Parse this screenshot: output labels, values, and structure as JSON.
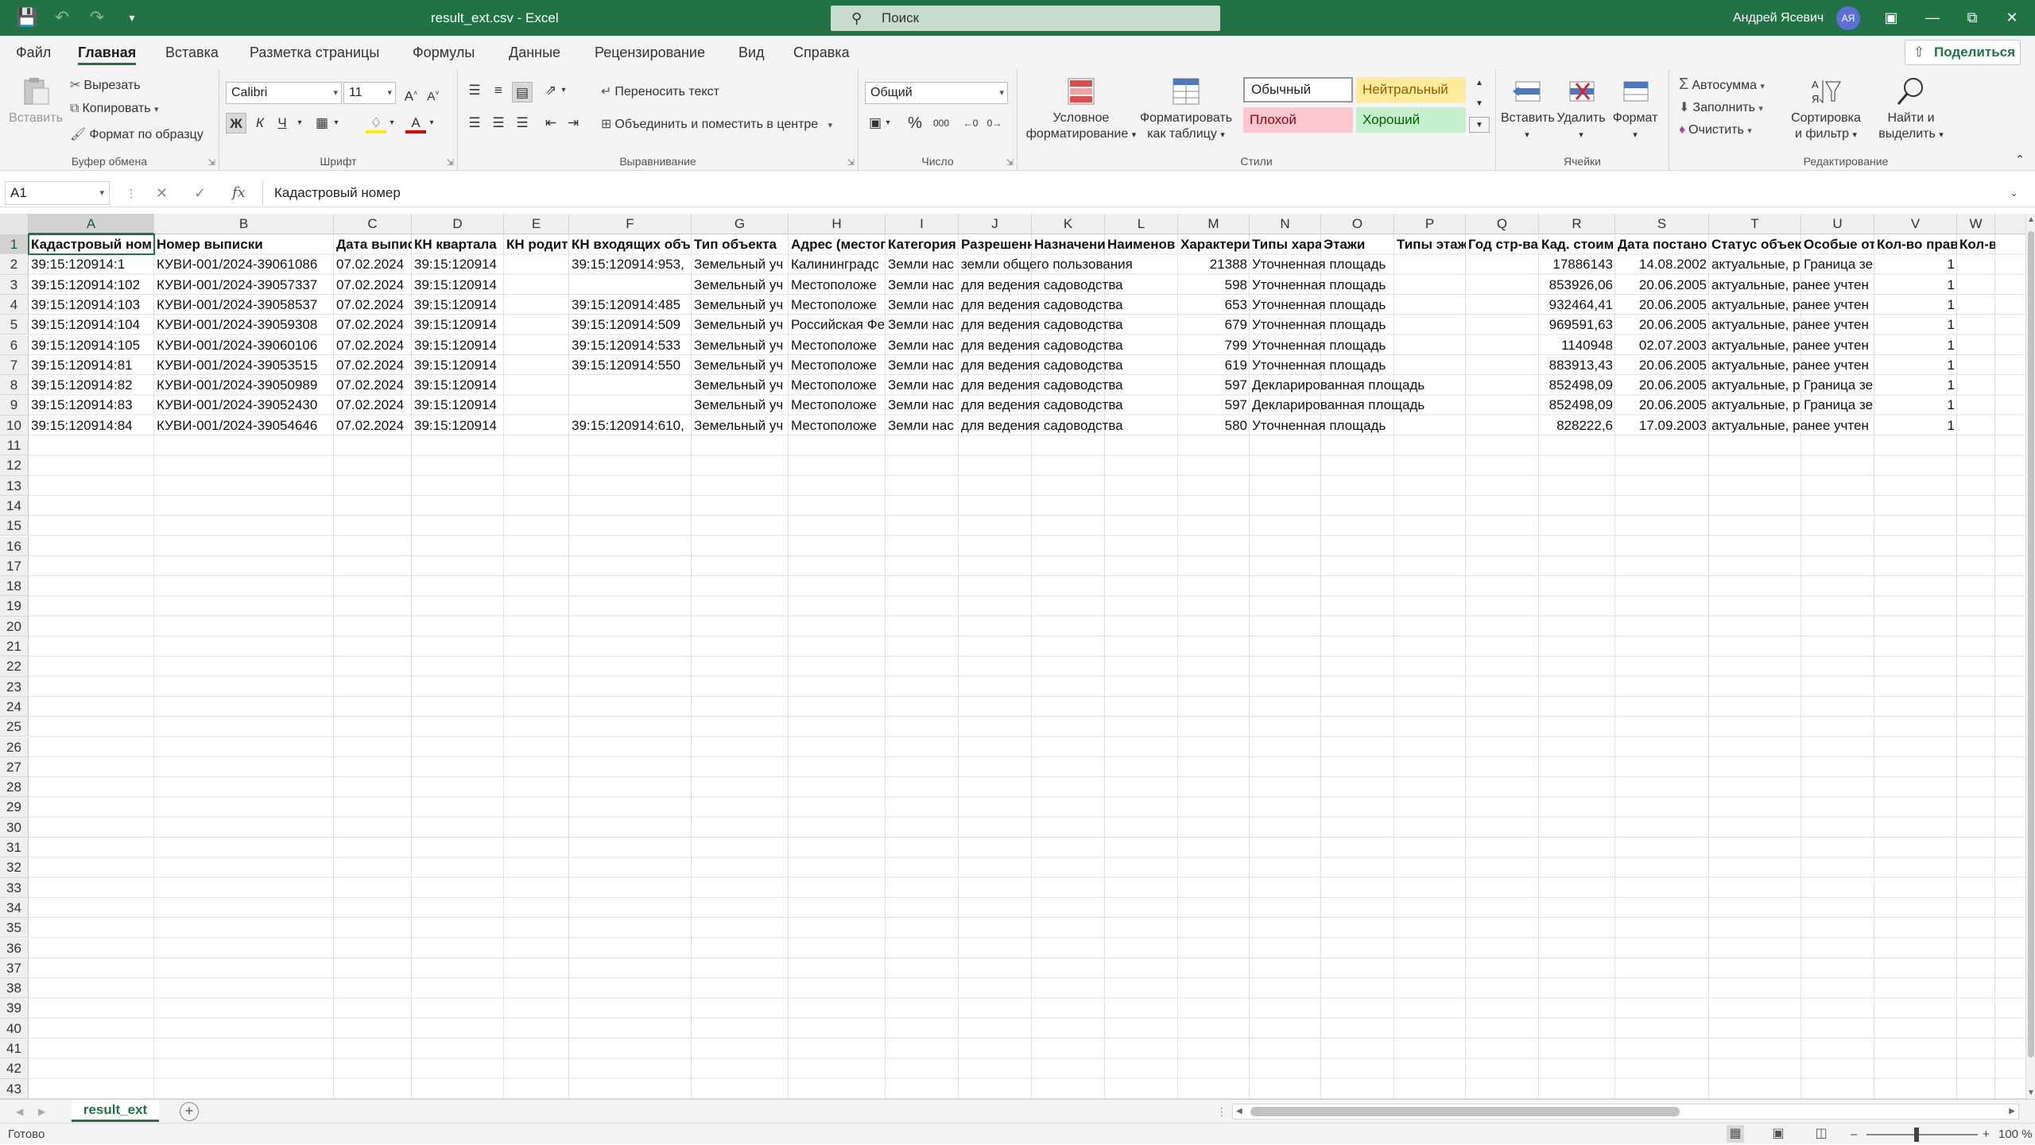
{
  "titlebar": {
    "title": "result_ext.csv  -  Excel",
    "search_placeholder": "Поиск",
    "user": "Андрей Ясевич",
    "avatar_initials": "АЯ"
  },
  "menu": {
    "tabs": [
      "Файл",
      "Главная",
      "Вставка",
      "Разметка страницы",
      "Формулы",
      "Данные",
      "Рецензирование",
      "Вид",
      "Справка"
    ],
    "active": "Главная",
    "share": "Поделиться"
  },
  "ribbon": {
    "clipboard": {
      "label": "Буфер обмена",
      "paste": "Вставить",
      "cut": "Вырезать",
      "copy": "Копировать",
      "format_painter": "Формат по образцу"
    },
    "font": {
      "label": "Шрифт",
      "name": "Calibri",
      "size": "11",
      "bold": "Ж",
      "italic": "К",
      "underline": "Ч"
    },
    "alignment": {
      "label": "Выравнивание",
      "wrap": "Переносить текст",
      "merge": "Объединить и поместить в центре"
    },
    "number": {
      "label": "Число",
      "format": "Общий",
      "percent": "%",
      "thousands": "000"
    },
    "styles": {
      "label": "Стили",
      "conditional_1": "Условное",
      "conditional_2": "форматирование",
      "as_table_1": "Форматировать",
      "as_table_2": "как таблицу",
      "normal": "Обычный",
      "neutral": "Нейтральный",
      "bad": "Плохой",
      "good": "Хороший"
    },
    "cells": {
      "label": "Ячейки",
      "insert": "Вставить",
      "delete": "Удалить",
      "format": "Формат"
    },
    "editing": {
      "label": "Редактирование",
      "autosum": "Автосумма",
      "fill": "Заполнить",
      "clear": "Очистить",
      "sort_1": "Сортировка",
      "sort_2": "и фильтр",
      "find_1": "Найти и",
      "find_2": "выделить"
    }
  },
  "formula_bar": {
    "name_box": "A1",
    "fx": "fx",
    "value": "Кадастровый номер"
  },
  "sheet": {
    "columns": [
      "A",
      "B",
      "C",
      "D",
      "E",
      "F",
      "G",
      "H",
      "I",
      "J",
      "K",
      "L",
      "M",
      "N",
      "O",
      "P",
      "Q",
      "R",
      "S",
      "T",
      "U",
      "V",
      "W"
    ],
    "row_numbers": [
      "1",
      "2",
      "3",
      "4",
      "5",
      "6",
      "7",
      "8",
      "9",
      "10",
      "11",
      "12",
      "13",
      "14",
      "15",
      "16",
      "17",
      "18",
      "19",
      "20",
      "21",
      "22",
      "23",
      "24",
      "25",
      "26",
      "27",
      "28",
      "29",
      "30",
      "31",
      "32",
      "33",
      "34",
      "35",
      "36",
      "37",
      "38",
      "39",
      "40",
      "41",
      "42",
      "43"
    ],
    "header_row": [
      "Кадастровый ном",
      "Номер выписки",
      "Дата выпис",
      "КН квартала",
      "КН родит",
      "КН входящих объ",
      "Тип объекта",
      "Адрес (местог",
      "Категория",
      "Разрешенн",
      "Назначени",
      "Наименов",
      "Характери",
      "Типы хара",
      "Этажи",
      "Типы этаж",
      "Год стр-ва",
      "Кад. стоим",
      "Дата постано",
      "Статус объект",
      "Особые от",
      "Кол-во прав",
      "Кол-во об"
    ],
    "data_rows": [
      [
        "39:15:120914:1",
        "КУВИ-001/2024-39061086",
        "07.02.2024",
        "39:15:120914",
        "",
        "39:15:120914:953,",
        "Земельный уч",
        "Калининградс",
        "Земли нас",
        "земли общего пользования",
        "",
        "",
        "21388",
        "Уточненная площадь",
        "",
        "",
        "",
        "17886143",
        "14.08.2002",
        "актуальные, р",
        "Граница зе",
        "1",
        ""
      ],
      [
        "39:15:120914:102",
        "КУВИ-001/2024-39057337",
        "07.02.2024",
        "39:15:120914",
        "",
        "",
        "Земельный уч",
        "Местоположе",
        "Земли нас",
        "для ведения садоводства",
        "",
        "",
        "598",
        "Уточненная площадь",
        "",
        "",
        "",
        "853926,06",
        "20.06.2005",
        "актуальные, ранее учтен",
        "",
        "1",
        ""
      ],
      [
        "39:15:120914:103",
        "КУВИ-001/2024-39058537",
        "07.02.2024",
        "39:15:120914",
        "",
        "39:15:120914:485",
        "Земельный уч",
        "Местоположе",
        "Земли нас",
        "для ведения садоводства",
        "",
        "",
        "653",
        "Уточненная площадь",
        "",
        "",
        "",
        "932464,41",
        "20.06.2005",
        "актуальные, ранее учтен",
        "",
        "1",
        ""
      ],
      [
        "39:15:120914:104",
        "КУВИ-001/2024-39059308",
        "07.02.2024",
        "39:15:120914",
        "",
        "39:15:120914:509",
        "Земельный уч",
        "Российская Фе",
        "Земли нас",
        "для ведения садоводства",
        "",
        "",
        "679",
        "Уточненная площадь",
        "",
        "",
        "",
        "969591,63",
        "20.06.2005",
        "актуальные, ранее учтен",
        "",
        "1",
        ""
      ],
      [
        "39:15:120914:105",
        "КУВИ-001/2024-39060106",
        "07.02.2024",
        "39:15:120914",
        "",
        "39:15:120914:533",
        "Земельный уч",
        "Местоположе",
        "Земли нас",
        "для ведения садоводства",
        "",
        "",
        "799",
        "Уточненная площадь",
        "",
        "",
        "",
        "1140948",
        "02.07.2003",
        "актуальные, ранее учтен",
        "",
        "1",
        ""
      ],
      [
        "39:15:120914:81",
        "КУВИ-001/2024-39053515",
        "07.02.2024",
        "39:15:120914",
        "",
        "39:15:120914:550",
        "Земельный уч",
        "Местоположе",
        "Земли нас",
        "для ведения садоводства",
        "",
        "",
        "619",
        "Уточненная площадь",
        "",
        "",
        "",
        "883913,43",
        "20.06.2005",
        "актуальные, ранее учтен",
        "",
        "1",
        ""
      ],
      [
        "39:15:120914:82",
        "КУВИ-001/2024-39050989",
        "07.02.2024",
        "39:15:120914",
        "",
        "",
        "Земельный уч",
        "Местоположе",
        "Земли нас",
        "для ведения садоводства",
        "",
        "",
        "597",
        "Декларированная площадь",
        "",
        "",
        "",
        "852498,09",
        "20.06.2005",
        "актуальные, р",
        "Граница зе",
        "1",
        ""
      ],
      [
        "39:15:120914:83",
        "КУВИ-001/2024-39052430",
        "07.02.2024",
        "39:15:120914",
        "",
        "",
        "Земельный уч",
        "Местоположе",
        "Земли нас",
        "для ведения садоводства",
        "",
        "",
        "597",
        "Декларированная площадь",
        "",
        "",
        "",
        "852498,09",
        "20.06.2005",
        "актуальные, р",
        "Граница зе",
        "1",
        ""
      ],
      [
        "39:15:120914:84",
        "КУВИ-001/2024-39054646",
        "07.02.2024",
        "39:15:120914",
        "",
        "39:15:120914:610,",
        "Земельный уч",
        "Местоположе",
        "Земли нас",
        "для ведения садоводства",
        "",
        "",
        "580",
        "Уточненная площадь",
        "",
        "",
        "",
        "828222,6",
        "17.09.2003",
        "актуальные, ранее учтен",
        "",
        "1",
        ""
      ]
    ]
  },
  "sheet_tabs": {
    "active": "result_ext",
    "add": "+"
  },
  "status": {
    "ready": "Готово",
    "zoom": "100 %",
    "zoom_minus": "–",
    "zoom_plus": "+"
  },
  "colors": {
    "accent": "#217346",
    "neutral_bg": "#ffeb9c",
    "bad_bg": "#ffc7ce",
    "good_bg": "#c6efce"
  }
}
